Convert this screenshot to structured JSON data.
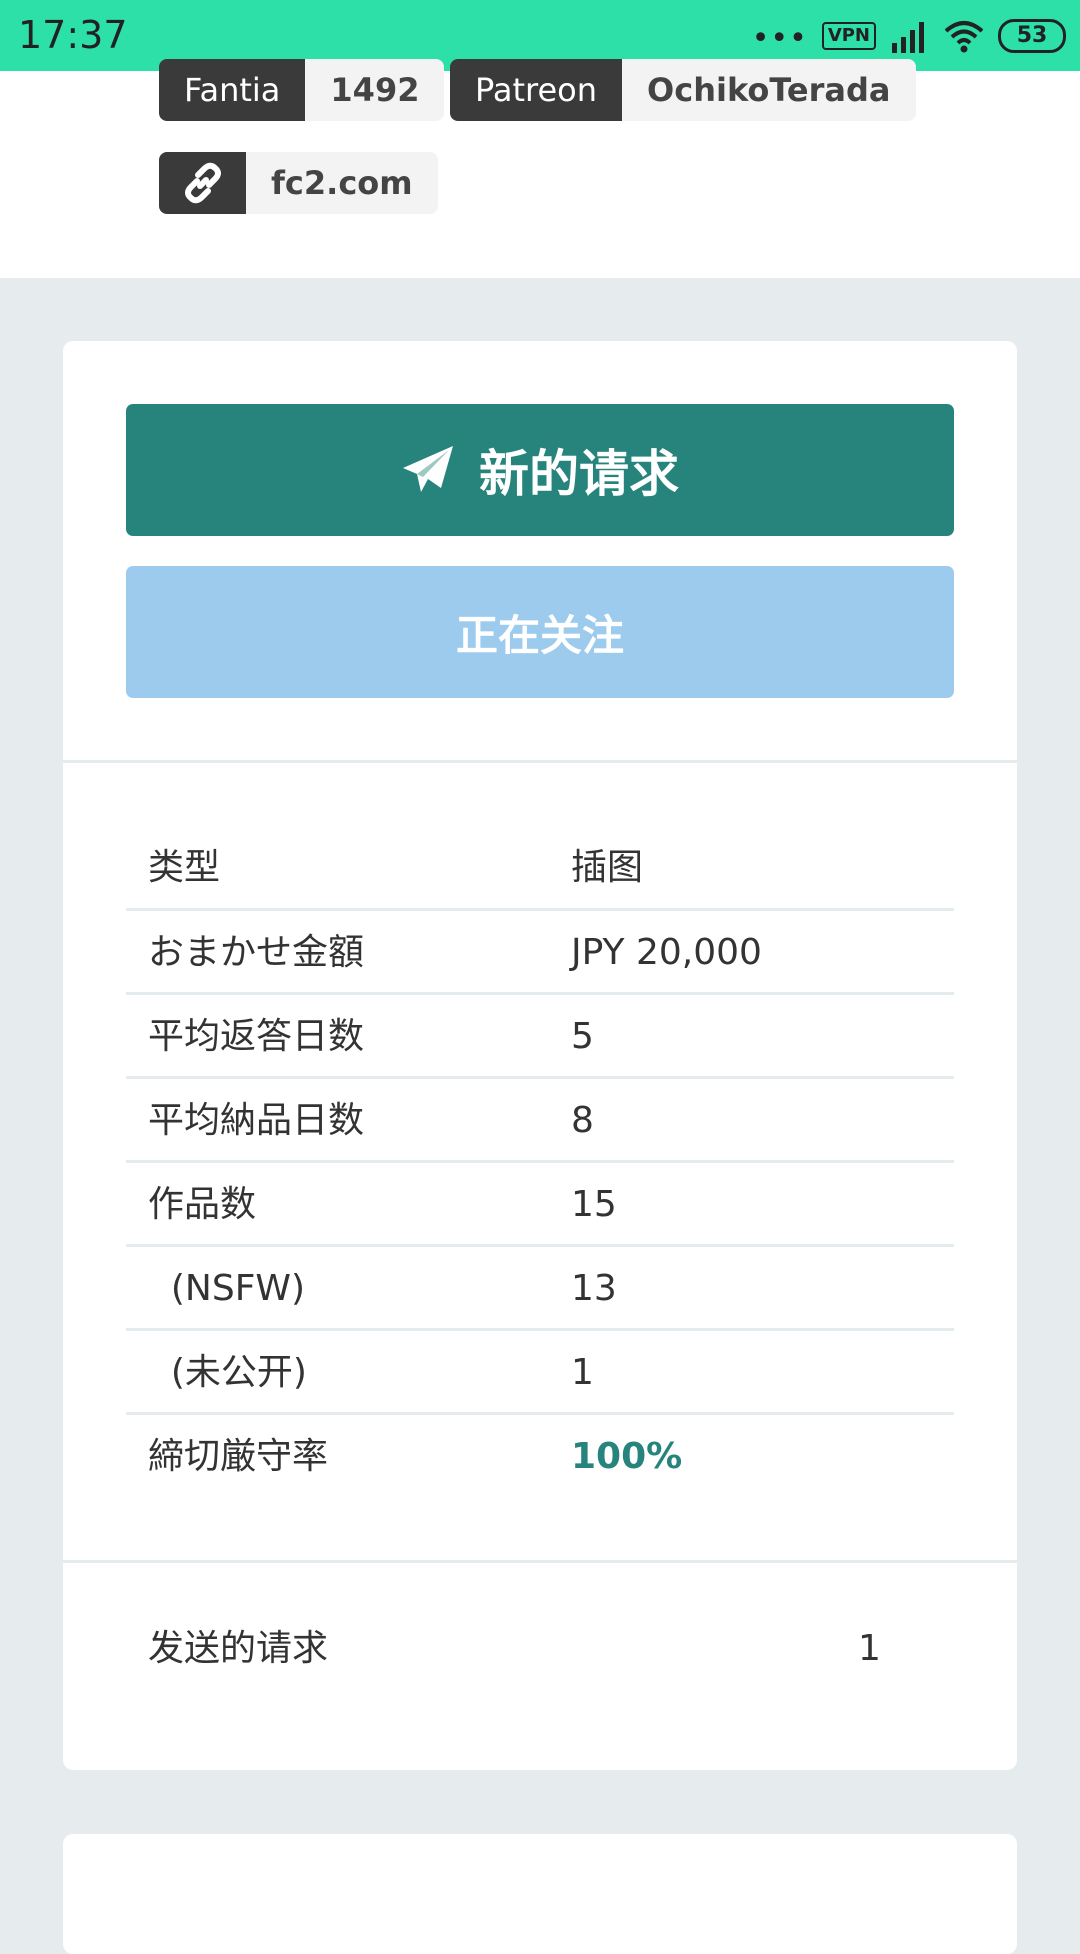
{
  "status_bar": {
    "time": "17:37",
    "dots": "•••",
    "vpn": "VPN",
    "battery": "53"
  },
  "links": [
    {
      "label": "Fantia",
      "value": "1492"
    },
    {
      "label": "Patreon",
      "value": "OchikoTerada"
    },
    {
      "icon": "link-icon",
      "value": "fc2.com"
    }
  ],
  "actions": {
    "new_request_label": "新的请求",
    "new_request_icon": "paper-plane-icon",
    "following_label": "正在关注"
  },
  "details": [
    {
      "key": "类型",
      "value": "插图"
    },
    {
      "key": "おまかせ金額",
      "value": "JPY 20,000"
    },
    {
      "key": "平均返答日数",
      "value": "5"
    },
    {
      "key": "平均納品日数",
      "value": "8"
    },
    {
      "key": "作品数",
      "value": "15"
    },
    {
      "key": "  (NSFW)",
      "value": "13"
    },
    {
      "key": "  (未公开)",
      "value": "1"
    },
    {
      "key": "締切厳守率",
      "value": "100%"
    }
  ],
  "sent_requests": {
    "label": "发送的请求",
    "value": "1"
  },
  "colors": {
    "accent": "#27847c",
    "status_bar": "#2de0a7",
    "follow_button": "#9ccbee",
    "page_bg": "#e6ebee"
  }
}
